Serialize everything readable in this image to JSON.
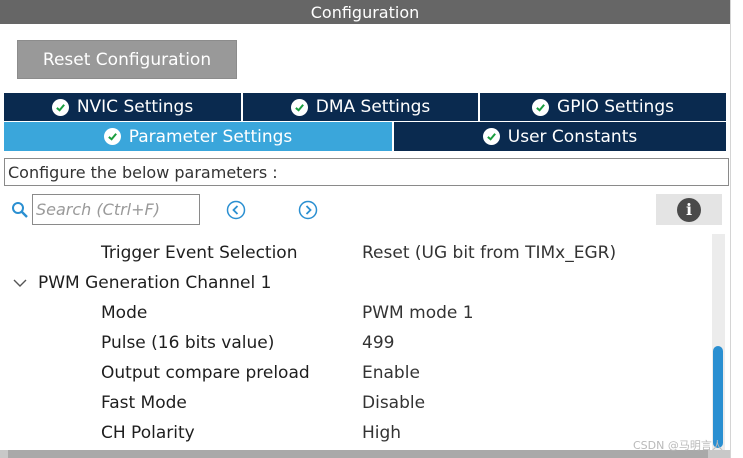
{
  "window": {
    "title": "Configuration"
  },
  "reset_button": {
    "label": "Reset Configuration"
  },
  "tabs_row1": [
    {
      "label": "NVIC Settings"
    },
    {
      "label": "DMA Settings"
    },
    {
      "label": "GPIO Settings"
    }
  ],
  "tabs_row2": [
    {
      "label": "Parameter Settings",
      "active": true
    },
    {
      "label": "User Constants",
      "active": false
    }
  ],
  "parameters_header": "Configure the below parameters :",
  "search": {
    "placeholder": "Search (Ctrl+F)",
    "value": ""
  },
  "info_button": {
    "icon": "i"
  },
  "tree": {
    "top_row": {
      "label": "Trigger Event Selection",
      "value": "Reset (UG bit from TIMx_EGR)"
    },
    "group": {
      "label": "PWM Generation Channel 1",
      "expanded": true
    },
    "params": [
      {
        "label": "Mode",
        "value": "PWM mode 1"
      },
      {
        "label": "Pulse (16 bits value)",
        "value": "499"
      },
      {
        "label": "Output compare preload",
        "value": "Enable"
      },
      {
        "label": "Fast Mode",
        "value": "Disable"
      },
      {
        "label": "CH Polarity",
        "value": "High"
      }
    ]
  },
  "watermark": "CSDN @马明言人",
  "colors": {
    "tab_dark": "#0a2a4f",
    "tab_active": "#3aa6db",
    "button_gray": "#999999",
    "title_gray": "#666666",
    "scroll_thumb": "#2a8fd1"
  }
}
